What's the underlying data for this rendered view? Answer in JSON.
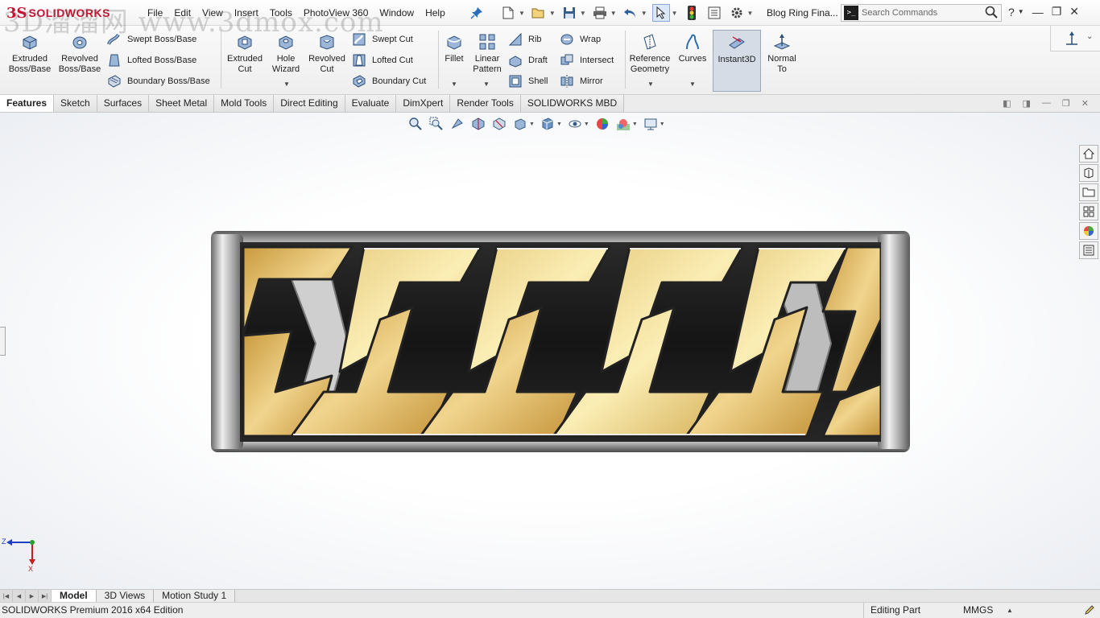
{
  "app": {
    "logo_text": "SOLIDWORKS",
    "document_title": "Blog Ring Fina..."
  },
  "menu": [
    "File",
    "Edit",
    "View",
    "Insert",
    "Tools",
    "PhotoView 360",
    "Window",
    "Help"
  ],
  "search": {
    "placeholder": "Search Commands"
  },
  "ribbon": {
    "extruded_boss": "Extruded Boss/Base",
    "revolved_boss": "Revolved Boss/Base",
    "swept_boss": "Swept Boss/Base",
    "lofted_boss": "Lofted Boss/Base",
    "boundary_boss": "Boundary Boss/Base",
    "extruded_cut": "Extruded Cut",
    "hole_wizard": "Hole Wizard",
    "revolved_cut": "Revolved Cut",
    "swept_cut": "Swept Cut",
    "lofted_cut": "Lofted Cut",
    "boundary_cut": "Boundary Cut",
    "fillet": "Fillet",
    "linear_pattern": "Linear Pattern",
    "rib": "Rib",
    "draft": "Draft",
    "shell": "Shell",
    "wrap": "Wrap",
    "intersect": "Intersect",
    "mirror": "Mirror",
    "reference_geometry": "Reference Geometry",
    "curves": "Curves",
    "instant3d": "Instant3D",
    "normal_to": "Normal To"
  },
  "tabs": [
    "Features",
    "Sketch",
    "Surfaces",
    "Sheet Metal",
    "Mold Tools",
    "Direct Editing",
    "Evaluate",
    "DimXpert",
    "Render Tools",
    "SOLIDWORKS MBD"
  ],
  "active_tab": "Features",
  "bottom_tabs": [
    "Model",
    "3D Views",
    "Motion Study 1"
  ],
  "status": {
    "product": "SOLIDWORKS Premium 2016 x64 Edition",
    "mode": "Editing Part",
    "units": "MMGS"
  },
  "triad": {
    "z": "Z",
    "x": "X"
  },
  "watermark": "3D溜溜网 www.3dmox.com",
  "colors": {
    "brand": "#c8102e",
    "gold": "#d9b255",
    "silver": "#c9c9c9",
    "accent": "#2a6ebb"
  }
}
